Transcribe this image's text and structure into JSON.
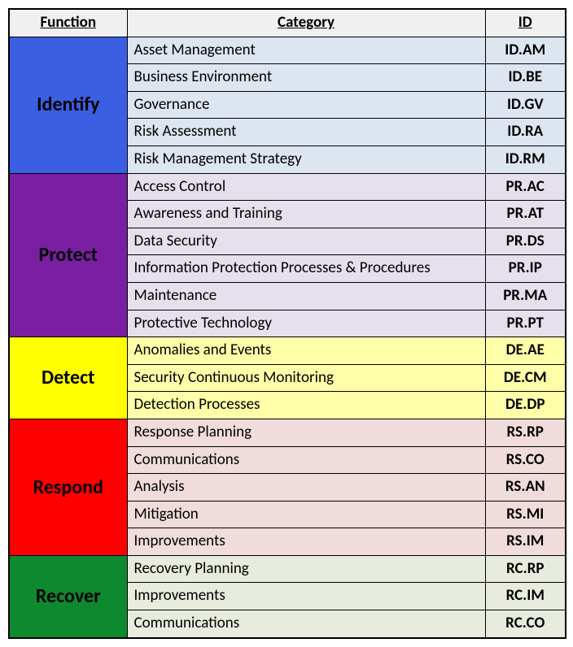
{
  "headers": {
    "function": "Function",
    "category": "Category",
    "id": "ID"
  },
  "functions": [
    {
      "name": "Identify",
      "key": "identify",
      "categories": [
        {
          "label": "Asset Management",
          "id": "ID.AM"
        },
        {
          "label": "Business Environment",
          "id": "ID.BE"
        },
        {
          "label": "Governance",
          "id": "ID.GV"
        },
        {
          "label": "Risk Assessment",
          "id": "ID.RA"
        },
        {
          "label": "Risk Management Strategy",
          "id": "ID.RM"
        }
      ]
    },
    {
      "name": "Protect",
      "key": "protect",
      "categories": [
        {
          "label": "Access Control",
          "id": "PR.AC"
        },
        {
          "label": "Awareness and Training",
          "id": "PR.AT"
        },
        {
          "label": "Data Security",
          "id": "PR.DS"
        },
        {
          "label": "Information Protection Processes & Procedures",
          "id": "PR.IP"
        },
        {
          "label": "Maintenance",
          "id": "PR.MA"
        },
        {
          "label": "Protective Technology",
          "id": "PR.PT"
        }
      ]
    },
    {
      "name": "Detect",
      "key": "detect",
      "categories": [
        {
          "label": "Anomalies and Events",
          "id": "DE.AE"
        },
        {
          "label": "Security Continuous Monitoring",
          "id": "DE.CM"
        },
        {
          "label": "Detection Processes",
          "id": "DE.DP"
        }
      ]
    },
    {
      "name": "Respond",
      "key": "respond",
      "categories": [
        {
          "label": "Response Planning",
          "id": "RS.RP"
        },
        {
          "label": "Communications",
          "id": "RS.CO"
        },
        {
          "label": "Analysis",
          "id": "RS.AN"
        },
        {
          "label": "Mitigation",
          "id": "RS.MI"
        },
        {
          "label": "Improvements",
          "id": "RS.IM"
        }
      ]
    },
    {
      "name": "Recover",
      "key": "recover",
      "categories": [
        {
          "label": "Recovery Planning",
          "id": "RC.RP"
        },
        {
          "label": "Improvements",
          "id": "RC.IM"
        },
        {
          "label": "Communications",
          "id": "RC.CO"
        }
      ]
    }
  ]
}
